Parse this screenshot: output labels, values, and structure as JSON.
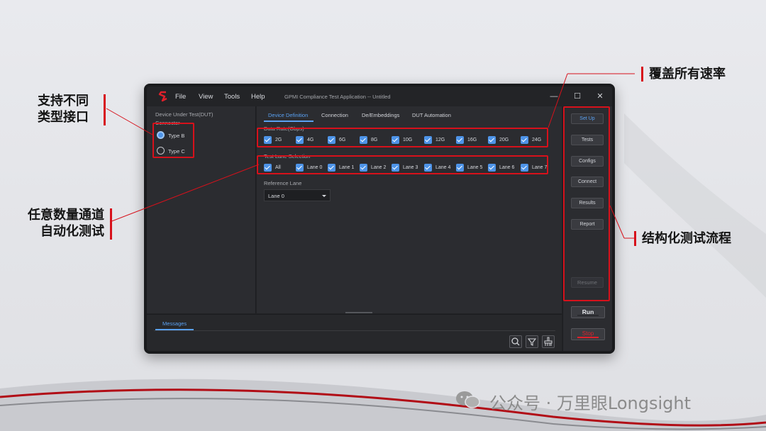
{
  "colors": {
    "accent": "#4e94e8",
    "highlight": "#d7111b",
    "stop": "#e0202b"
  },
  "window": {
    "logo_icon": "s-logo-icon",
    "menu": [
      "File",
      "View",
      "Tools",
      "Help"
    ],
    "title": "GPMI Compliance Test Application -- Untitled",
    "controls": {
      "minimize": "—",
      "maximize": "☐",
      "close": "✕"
    }
  },
  "left_panel": {
    "dut_label": "Device Under Test(DUT)",
    "connector_label": "Connector",
    "options": [
      {
        "label": "Type B",
        "selected": true
      },
      {
        "label": "Type C",
        "selected": false
      }
    ]
  },
  "tabs": [
    "Device Definition",
    "Connection",
    "De/Embeddings",
    "DUT Automation"
  ],
  "data_rate": {
    "label": "Data Rate(Gbps)",
    "items": [
      "2G",
      "4G",
      "6G",
      "8G",
      "10G",
      "12G",
      "16G",
      "20G",
      "24G"
    ]
  },
  "lane_selection": {
    "label": "Test Lane Selection",
    "items": [
      "All",
      "Lane 0",
      "Lane 1",
      "Lane 2",
      "Lane 3",
      "Lane 4",
      "Lane 5",
      "Lane 6",
      "Lane 7"
    ]
  },
  "reference_lane": {
    "label": "Reference Lane",
    "value": "Lane 0"
  },
  "side_buttons": [
    "Set Up",
    "Tests",
    "Configs",
    "Connect",
    "Results",
    "Report"
  ],
  "resume_label": "Resume",
  "run_label": "Run",
  "stop_label": "Stop",
  "messages": {
    "tab": "Messages",
    "icons": [
      "search-icon",
      "filter-icon",
      "clear-icon"
    ]
  },
  "annotations": {
    "interfaces": [
      "支持不同",
      "类型接口"
    ],
    "lanes": [
      "任意数量通道",
      "自动化测试"
    ],
    "rates": "覆盖所有速率",
    "flow": "结构化测试流程"
  },
  "watermark": "公众号 · 万里眼Longsight"
}
